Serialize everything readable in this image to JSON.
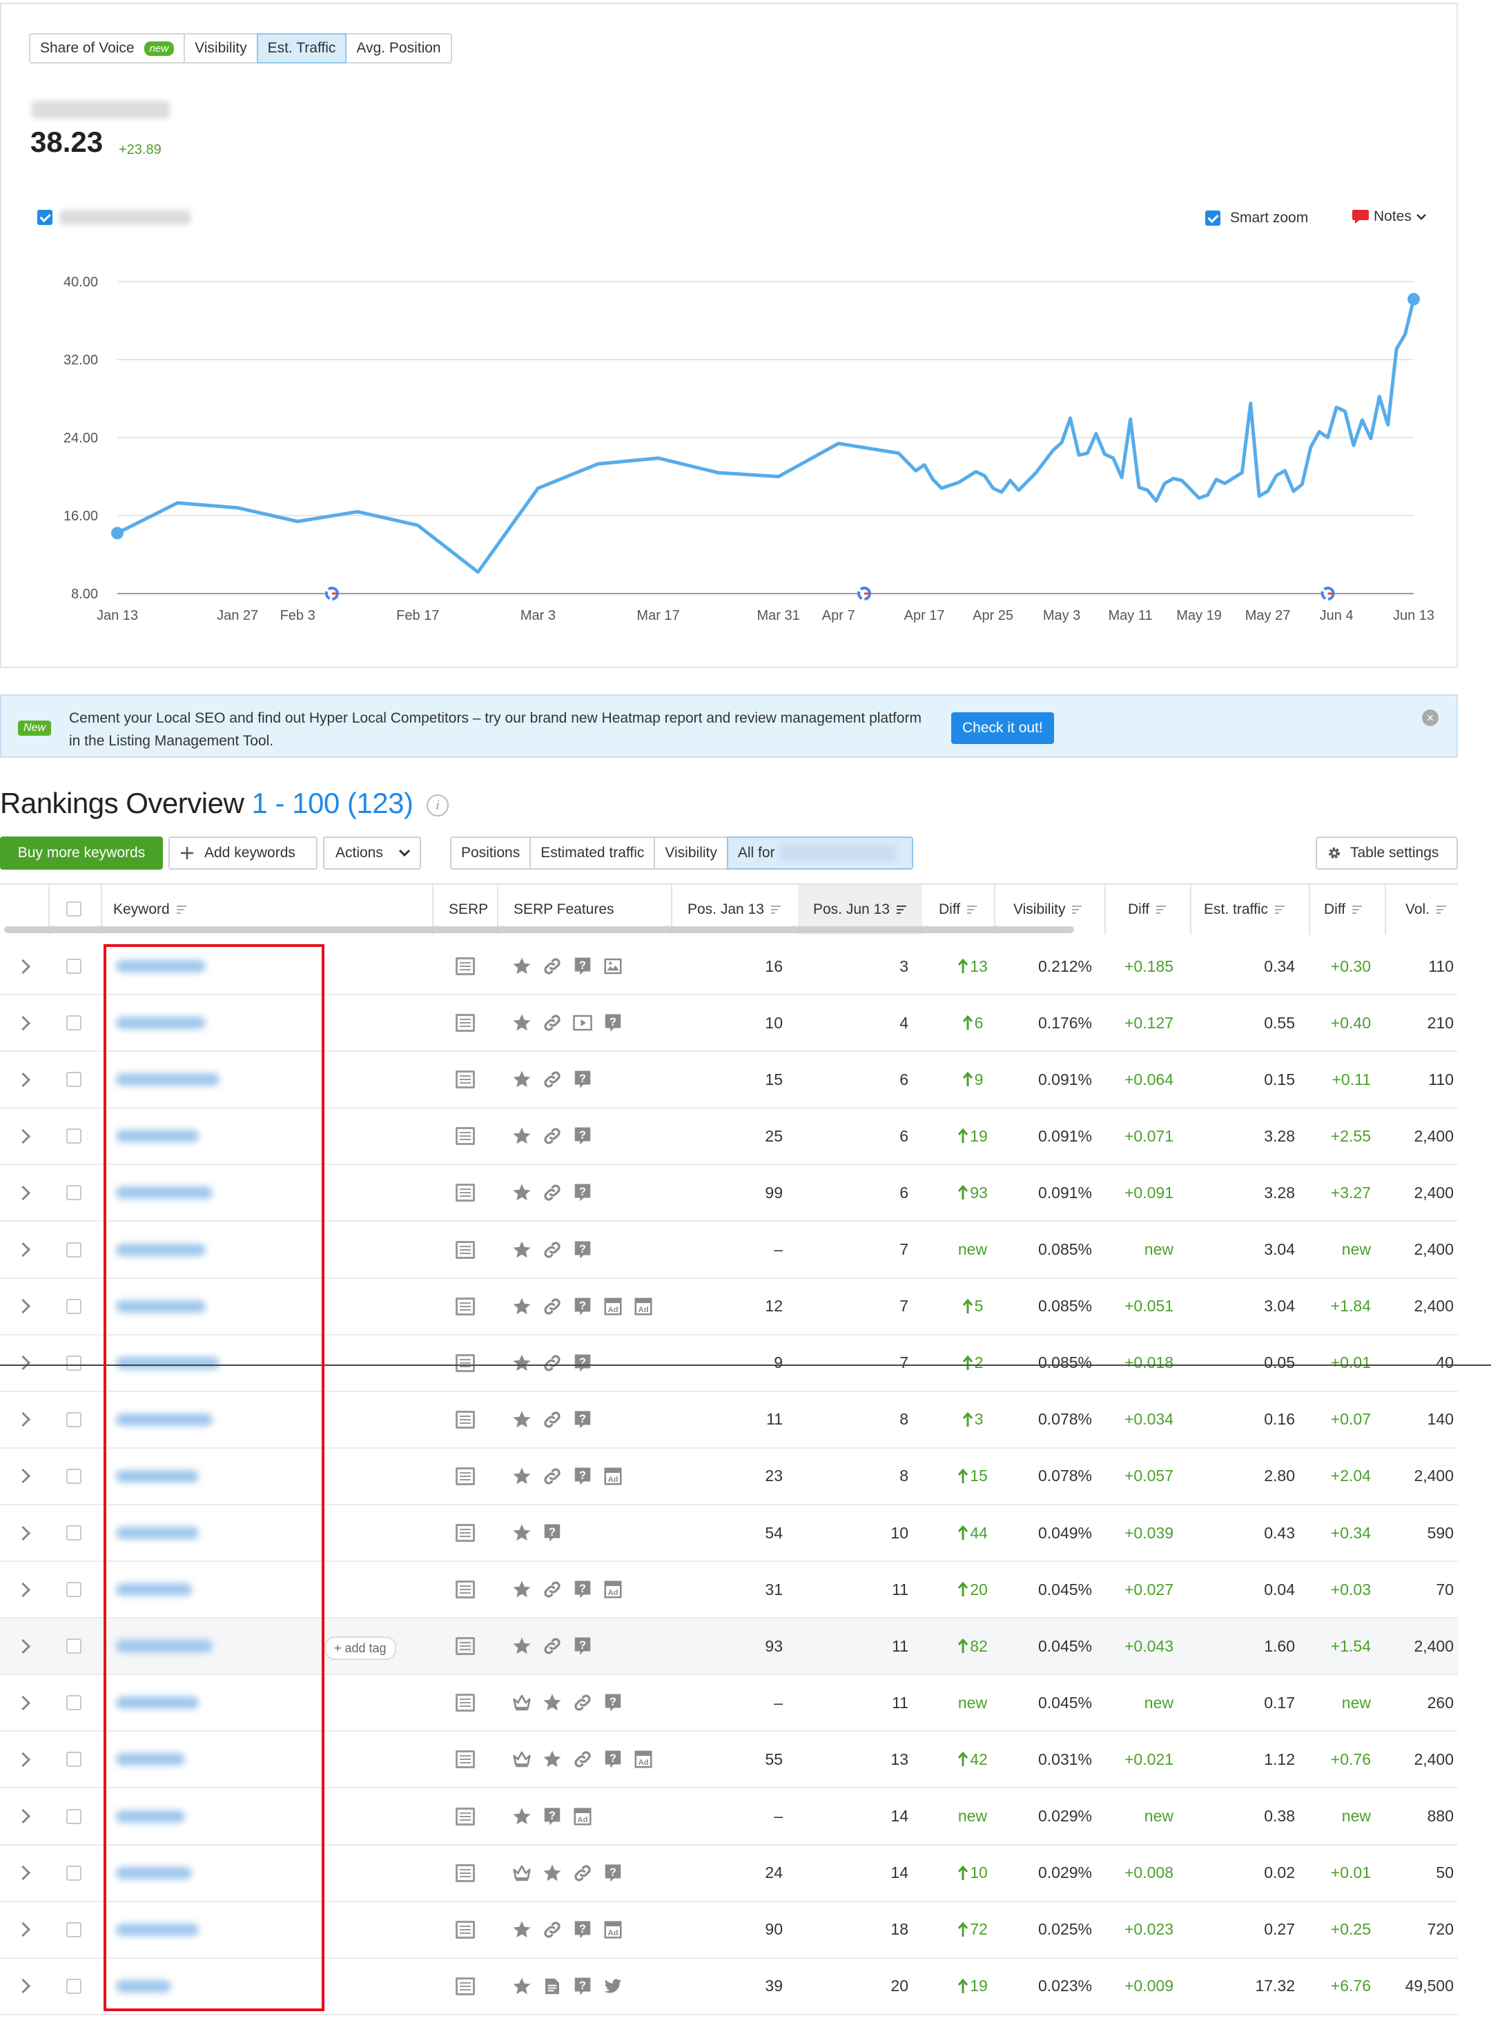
{
  "metric_tabs": [
    {
      "label": "Share of Voice",
      "badge": "new"
    },
    {
      "label": "Visibility"
    },
    {
      "label": "Est. Traffic",
      "active": true
    },
    {
      "label": "Avg. Position"
    }
  ],
  "metric": {
    "value": "38.23",
    "delta": "+23.89"
  },
  "controls": {
    "smart_zoom": "Smart zoom",
    "notes": "Notes"
  },
  "chart_data": {
    "type": "line",
    "ylim": [
      8,
      40
    ],
    "y_ticks": [
      "40.00",
      "32.00",
      "24.00",
      "16.00",
      "8.00"
    ],
    "x_tick_labels": [
      "Jan 13",
      "Jan 27",
      "Feb 3",
      "Feb 17",
      "Mar 3",
      "Mar 17",
      "Mar 31",
      "Apr 7",
      "Apr 17",
      "Apr 25",
      "May 3",
      "May 11",
      "May 19",
      "May 27",
      "Jun 4",
      "Jun 13"
    ],
    "google_update_markers_at": [
      "Feb 7",
      "Apr 10",
      "Jun 3"
    ],
    "color": "#56acea",
    "points": [
      [
        "Jan 13",
        14.2
      ],
      [
        "Jan 20",
        17.3
      ],
      [
        "Jan 27",
        16.8
      ],
      [
        "Feb 3",
        15.4
      ],
      [
        "Feb 10",
        16.4
      ],
      [
        "Feb 17",
        15.0
      ],
      [
        "Feb 24",
        10.2
      ],
      [
        "Mar 3",
        18.8
      ],
      [
        "Mar 10",
        21.3
      ],
      [
        "Mar 17",
        21.9
      ],
      [
        "Mar 24",
        20.4
      ],
      [
        "Mar 31",
        20.0
      ],
      [
        "Apr 7",
        23.4
      ],
      [
        "Apr 14",
        22.4
      ],
      [
        "Apr 16",
        20.6
      ],
      [
        "Apr 17",
        21.2
      ],
      [
        "Apr 18",
        19.7
      ],
      [
        "Apr 19",
        18.8
      ],
      [
        "Apr 21",
        19.4
      ],
      [
        "Apr 23",
        20.5
      ],
      [
        "Apr 24",
        20.1
      ],
      [
        "Apr 25",
        18.8
      ],
      [
        "Apr 26",
        18.4
      ],
      [
        "Apr 27",
        19.6
      ],
      [
        "Apr 28",
        18.6
      ],
      [
        "Apr 30",
        20.4
      ],
      [
        "May 2",
        22.7
      ],
      [
        "May 3",
        23.5
      ],
      [
        "May 4",
        26.0
      ],
      [
        "May 5",
        22.2
      ],
      [
        "May 6",
        22.4
      ],
      [
        "May 7",
        24.4
      ],
      [
        "May 8",
        22.3
      ],
      [
        "May 9",
        21.9
      ],
      [
        "May 10",
        19.9
      ],
      [
        "May 11",
        25.9
      ],
      [
        "May 12",
        18.9
      ],
      [
        "May 13",
        18.6
      ],
      [
        "May 14",
        17.5
      ],
      [
        "May 15",
        19.3
      ],
      [
        "May 16",
        19.8
      ],
      [
        "May 17",
        19.6
      ],
      [
        "May 18",
        18.7
      ],
      [
        "May 19",
        17.8
      ],
      [
        "May 20",
        18.1
      ],
      [
        "May 21",
        19.7
      ],
      [
        "May 22",
        19.3
      ],
      [
        "May 24",
        20.4
      ],
      [
        "May 25",
        27.5
      ],
      [
        "May 26",
        18.0
      ],
      [
        "May 27",
        18.5
      ],
      [
        "May 28",
        20.1
      ],
      [
        "May 29",
        20.6
      ],
      [
        "May 30",
        18.5
      ],
      [
        "May 31",
        19.2
      ],
      [
        "Jun 1",
        23.0
      ],
      [
        "Jun 2",
        24.6
      ],
      [
        "Jun 3",
        24.0
      ],
      [
        "Jun 4",
        27.1
      ],
      [
        "Jun 5",
        26.7
      ],
      [
        "Jun 6",
        23.2
      ],
      [
        "Jun 7",
        25.8
      ],
      [
        "Jun 8",
        23.9
      ],
      [
        "Jun 9",
        28.2
      ],
      [
        "Jun 10",
        25.3
      ],
      [
        "Jun 11",
        33.1
      ],
      [
        "Jun 12",
        34.6
      ],
      [
        "Jun 13",
        38.2
      ]
    ]
  },
  "banner": {
    "badge": "New",
    "text": "Cement your Local SEO and find out Hyper Local Competitors – try our brand new Heatmap report and review management platform in the Listing Management Tool.",
    "cta": "Check it out!",
    "close_glyph": "×"
  },
  "rankings": {
    "title": "Rankings Overview",
    "range": "1 - 100 (123)",
    "info_glyph": "i"
  },
  "toolbar": {
    "buy": "Buy more keywords",
    "add": "Add keywords",
    "actions": "Actions",
    "segments": [
      "Positions",
      "Estimated traffic",
      "Visibility",
      "All for"
    ],
    "settings": "Table settings"
  },
  "columns": [
    "Keyword",
    "SERP",
    "SERP Features",
    "Pos. Jan 13",
    "Pos. Jun 13",
    "Diff",
    "Visibility",
    "Diff",
    "Est. traffic",
    "Diff",
    "Vol."
  ],
  "add_tag": "+ add tag",
  "rows": [
    {
      "feats": [
        "star",
        "link",
        "faq",
        "image"
      ],
      "pos1": "16",
      "pos2": "3",
      "diff": "13",
      "diff_up": true,
      "vis": "0.212%",
      "vdiff": "+0.185",
      "traffic": "0.34",
      "tdiff": "+0.30",
      "vol": "110",
      "kw_w": 130
    },
    {
      "feats": [
        "star",
        "link",
        "video",
        "faq"
      ],
      "pos1": "10",
      "pos2": "4",
      "diff": "6",
      "diff_up": true,
      "vis": "0.176%",
      "vdiff": "+0.127",
      "traffic": "0.55",
      "tdiff": "+0.40",
      "vol": "210",
      "kw_w": 130
    },
    {
      "feats": [
        "star",
        "link",
        "faq"
      ],
      "pos1": "15",
      "pos2": "6",
      "diff": "9",
      "diff_up": true,
      "vis": "0.091%",
      "vdiff": "+0.064",
      "traffic": "0.15",
      "tdiff": "+0.11",
      "vol": "110",
      "kw_w": 150
    },
    {
      "feats": [
        "star",
        "link",
        "faq"
      ],
      "pos1": "25",
      "pos2": "6",
      "diff": "19",
      "diff_up": true,
      "vis": "0.091%",
      "vdiff": "+0.071",
      "traffic": "3.28",
      "tdiff": "+2.55",
      "vol": "2,400",
      "kw_w": 120
    },
    {
      "feats": [
        "star",
        "link",
        "faq"
      ],
      "pos1": "99",
      "pos2": "6",
      "diff": "93",
      "diff_up": true,
      "vis": "0.091%",
      "vdiff": "+0.091",
      "traffic": "3.28",
      "tdiff": "+3.27",
      "vol": "2,400",
      "kw_w": 140
    },
    {
      "feats": [
        "star",
        "link",
        "faq"
      ],
      "pos1": "–",
      "pos2": "7",
      "diff": "new",
      "diff_up": false,
      "vis": "0.085%",
      "vdiff": "new",
      "traffic": "3.04",
      "tdiff": "new",
      "vol": "2,400",
      "kw_w": 130
    },
    {
      "feats": [
        "star",
        "link",
        "faq",
        "ad",
        "ad"
      ],
      "pos1": "12",
      "pos2": "7",
      "diff": "5",
      "diff_up": true,
      "vis": "0.085%",
      "vdiff": "+0.051",
      "traffic": "3.04",
      "tdiff": "+1.84",
      "vol": "2,400",
      "kw_w": 130
    },
    {
      "feats": [
        "star",
        "link",
        "faq"
      ],
      "pos1": "9",
      "pos2": "7",
      "diff": "2",
      "diff_up": true,
      "vis": "0.085%",
      "vdiff": "+0.018",
      "traffic": "0.05",
      "tdiff": "+0.01",
      "vol": "40",
      "kw_w": 150
    },
    {
      "feats": [
        "star",
        "link",
        "faq"
      ],
      "pos1": "11",
      "pos2": "8",
      "diff": "3",
      "diff_up": true,
      "vis": "0.078%",
      "vdiff": "+0.034",
      "traffic": "0.16",
      "tdiff": "+0.07",
      "vol": "140",
      "kw_w": 140
    },
    {
      "feats": [
        "star",
        "link",
        "faq",
        "ad"
      ],
      "pos1": "23",
      "pos2": "8",
      "diff": "15",
      "diff_up": true,
      "vis": "0.078%",
      "vdiff": "+0.057",
      "traffic": "2.80",
      "tdiff": "+2.04",
      "vol": "2,400",
      "kw_w": 120
    },
    {
      "feats": [
        "star",
        "faq"
      ],
      "pos1": "54",
      "pos2": "10",
      "diff": "44",
      "diff_up": true,
      "vis": "0.049%",
      "vdiff": "+0.039",
      "traffic": "0.43",
      "tdiff": "+0.34",
      "vol": "590",
      "kw_w": 120
    },
    {
      "feats": [
        "star",
        "link",
        "faq",
        "ad"
      ],
      "pos1": "31",
      "pos2": "11",
      "diff": "20",
      "diff_up": true,
      "vis": "0.045%",
      "vdiff": "+0.027",
      "traffic": "0.04",
      "tdiff": "+0.03",
      "vol": "70",
      "kw_w": 110
    },
    {
      "feats": [
        "star",
        "link",
        "faq"
      ],
      "pos1": "93",
      "pos2": "11",
      "diff": "82",
      "diff_up": true,
      "vis": "0.045%",
      "vdiff": "+0.043",
      "traffic": "1.60",
      "tdiff": "+1.54",
      "vol": "2,400",
      "kw_w": 140,
      "hl": true
    },
    {
      "feats": [
        "crown",
        "star",
        "link",
        "faq"
      ],
      "pos1": "–",
      "pos2": "11",
      "diff": "new",
      "diff_up": false,
      "vis": "0.045%",
      "vdiff": "new",
      "traffic": "0.17",
      "tdiff": "new",
      "vol": "260",
      "kw_w": 120
    },
    {
      "feats": [
        "crown",
        "star",
        "link",
        "faq",
        "ad"
      ],
      "pos1": "55",
      "pos2": "13",
      "diff": "42",
      "diff_up": true,
      "vis": "0.031%",
      "vdiff": "+0.021",
      "traffic": "1.12",
      "tdiff": "+0.76",
      "vol": "2,400",
      "kw_w": 100
    },
    {
      "feats": [
        "star",
        "faq",
        "ad"
      ],
      "pos1": "–",
      "pos2": "14",
      "diff": "new",
      "diff_up": false,
      "vis": "0.029%",
      "vdiff": "new",
      "traffic": "0.38",
      "tdiff": "new",
      "vol": "880",
      "kw_w": 100
    },
    {
      "feats": [
        "crown",
        "star",
        "link",
        "faq"
      ],
      "pos1": "24",
      "pos2": "14",
      "diff": "10",
      "diff_up": true,
      "vis": "0.029%",
      "vdiff": "+0.008",
      "traffic": "0.02",
      "tdiff": "+0.01",
      "vol": "50",
      "kw_w": 110
    },
    {
      "feats": [
        "star",
        "link",
        "faq",
        "ad"
      ],
      "pos1": "90",
      "pos2": "18",
      "diff": "72",
      "diff_up": true,
      "vis": "0.025%",
      "vdiff": "+0.023",
      "traffic": "0.27",
      "tdiff": "+0.25",
      "vol": "720",
      "kw_w": 120
    },
    {
      "feats": [
        "star",
        "doc",
        "faq",
        "twitter"
      ],
      "pos1": "39",
      "pos2": "20",
      "diff": "19",
      "diff_up": true,
      "vis": "0.023%",
      "vdiff": "+0.009",
      "traffic": "17.32",
      "tdiff": "+6.76",
      "vol": "49,500",
      "kw_w": 80
    }
  ]
}
